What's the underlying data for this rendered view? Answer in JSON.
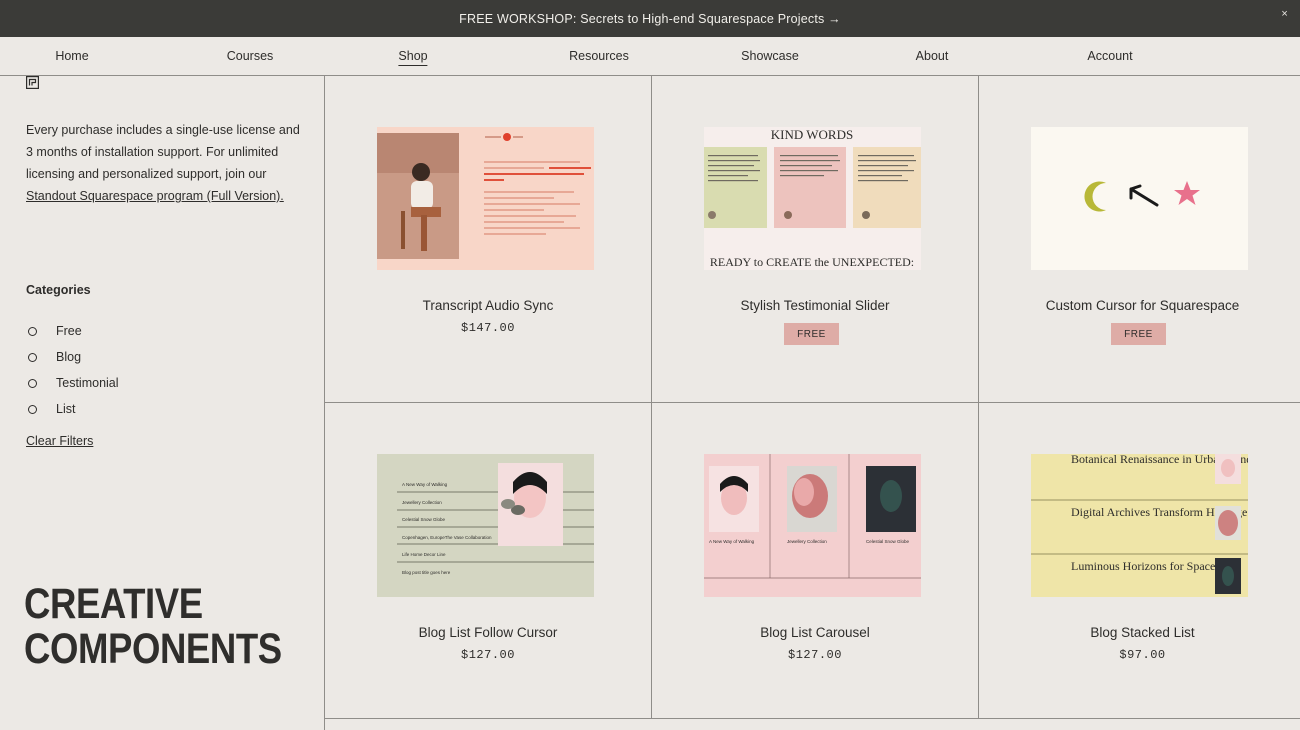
{
  "promo": {
    "text": "FREE WORKSHOP: Secrets to High-end Squarespace Projects →",
    "close": "×"
  },
  "nav": {
    "items": [
      "Home",
      "Courses",
      "Shop",
      "Resources",
      "Showcase",
      "About",
      "Account"
    ],
    "active": "Shop"
  },
  "sidebar": {
    "intro": "Every purchase includes a single-use license and 3 months of installation support. For unlimited licensing and personalized support, join our ",
    "intro_link": "Standout Squarespace program (Full Version).",
    "categories_title": "Categories",
    "categories": [
      "Free",
      "Blog",
      "Testimonial",
      "List"
    ],
    "clear_filters": "Clear Filters",
    "big_title_line1": "CREATIVE",
    "big_title_line2": "COMPONENTS"
  },
  "products": [
    {
      "title": "Transcript Audio Sync",
      "price": "$147.00"
    },
    {
      "title": "Stylish Testimonial Slider",
      "badge": "FREE"
    },
    {
      "title": "Custom Cursor for Squarespace",
      "badge": "FREE"
    },
    {
      "title": "Blog List Follow Cursor",
      "price": "$127.00"
    },
    {
      "title": "Blog List Carousel",
      "price": "$127.00"
    },
    {
      "title": "Blog Stacked List",
      "price": "$97.00"
    }
  ],
  "thumbs": {
    "testimonial_heading": "KIND WORDS",
    "testimonial_footer": "READY to CREATE the UNEXPECTED:",
    "follow_items": [
      "A New Way of Walking",
      "Jewellery Collection",
      "Celestial Snow Globe",
      "Copenhagen, EuropeThe Vase Collaboration",
      "Life Home Decor Line",
      "Blog post title goes here"
    ],
    "carousel_items": [
      "A New Way of Walking",
      "Jewellery Collection",
      "Celestial Snow Globe"
    ],
    "stacked_items": [
      "Botanical Renaissance in Urban Landscapes",
      "Digital Archives Transform Heritage Textiles",
      "Luminous Horizons for Spaces"
    ]
  },
  "colors": {
    "promo_bg": "#3b3b38",
    "page_bg": "#ece9e5",
    "badge_bg": "#deaca6",
    "divider": "#8f8d89"
  }
}
